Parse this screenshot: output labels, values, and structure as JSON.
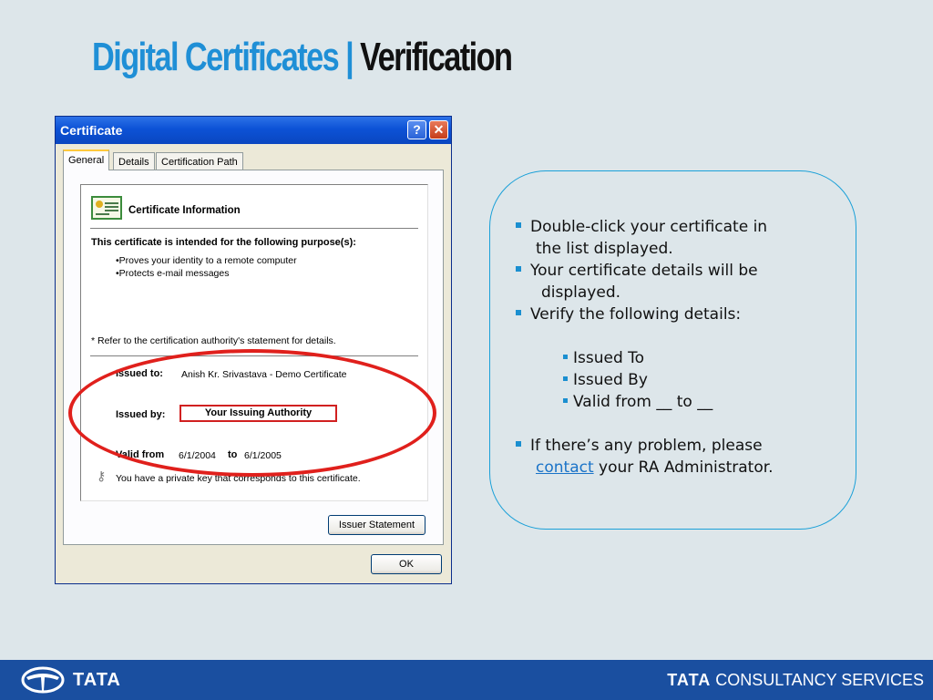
{
  "slide": {
    "title_part1": "Digital Certificates |",
    "title_part2": "Verification"
  },
  "dialog": {
    "title": "Certificate",
    "help_glyph": "?",
    "close_glyph": "✕",
    "tabs": [
      {
        "label": "General",
        "active": true
      },
      {
        "label": "Details",
        "active": false
      },
      {
        "label": "Certification Path",
        "active": false
      }
    ],
    "info": {
      "heading": "Certificate Information",
      "purpose_heading": "This certificate is intended for the following purpose(s):",
      "purposes": [
        "•Proves your identity to a remote computer",
        "•Protects e-mail messages"
      ],
      "refer_note": "* Refer to the certification authority's statement for details.",
      "issued_to_label": "Issued to:",
      "issued_to_value": "Anish Kr. Srivastava - Demo Certificate",
      "issued_by_label": "Issued by:",
      "issued_by_value": "Your Issuing Authority",
      "valid_from_label": "Valid from",
      "valid_from_value": "6/1/2004",
      "valid_to_label": "to",
      "valid_to_value": "6/1/2005",
      "private_key_note": "You have a private key that corresponds to this certificate."
    },
    "issuer_statement_button": "Issuer Statement",
    "ok_button": "OK"
  },
  "instructions": {
    "step1_line1": "Double-click your certificate in",
    "step1_line2": "the list displayed.",
    "step2_line1": "Your certificate details will be",
    "step2_line2": "displayed.",
    "step3": "Verify the following details:",
    "details": [
      "Issued To",
      "Issued By",
      "Valid from __ to __"
    ],
    "step4_line1": "If there’s any problem, please",
    "step4_link": "contact",
    "step4_rest": "your RA Administrator."
  },
  "footer": {
    "left_logo": "TATA",
    "right_logo_bold": "TATA",
    "right_logo_text": "CONSULTANCY SERVICES"
  },
  "colors": {
    "title_blue": "#1f8fd6",
    "footer_blue": "#1a4fa0",
    "highlight_red": "#e0201c",
    "bubble_border": "#1aa0d8"
  }
}
